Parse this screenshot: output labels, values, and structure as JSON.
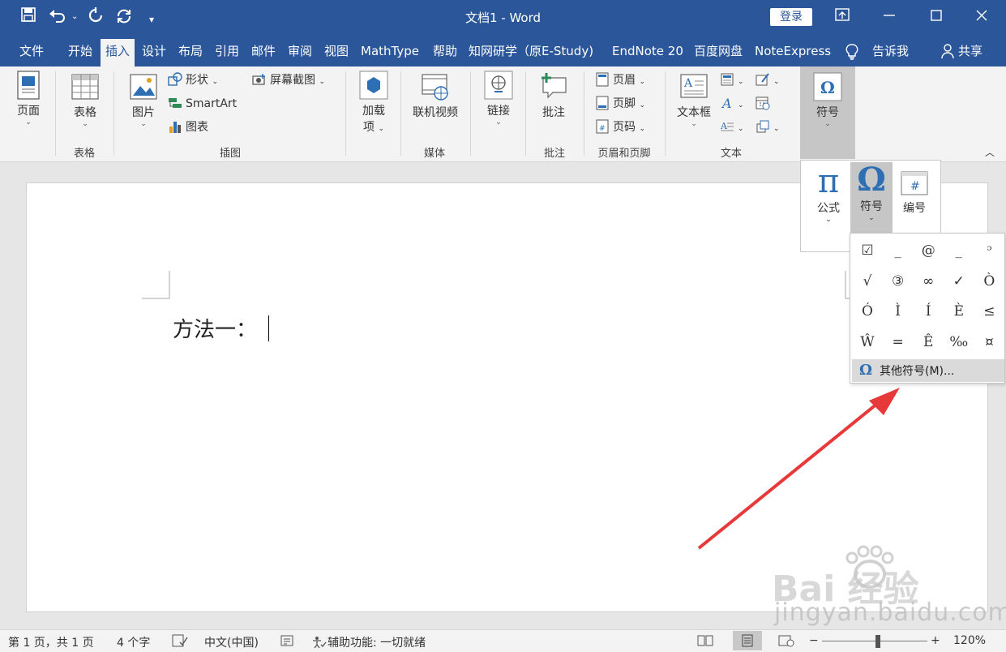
{
  "titlebar": {
    "title": "文档1  -  Word",
    "login_label": "登录",
    "quick_access": [
      "save-icon",
      "undo-icon",
      "redo-icon",
      "refresh-icon",
      "customize-icon"
    ]
  },
  "menu": {
    "tabs": [
      "文件",
      "开始",
      "插入",
      "设计",
      "布局",
      "引用",
      "邮件",
      "审阅",
      "视图",
      "MathType",
      "帮助",
      "知网研学（原E-Study)",
      "EndNote 20",
      "百度网盘",
      "NoteExpress",
      "告诉我",
      "共享"
    ],
    "active": "插入"
  },
  "ribbon": {
    "pages": {
      "label": "页面"
    },
    "table": {
      "label": "表格",
      "group": "表格"
    },
    "illustrations": {
      "picture": "图片",
      "shapes": "形状",
      "smartart": "SmartArt",
      "chart": "图表",
      "screenshot": "屏幕截图",
      "group": "插图"
    },
    "addins": {
      "label": "加载",
      "label2": "项"
    },
    "media": {
      "label": "联机视频",
      "group": "媒体"
    },
    "links": {
      "label": "链接"
    },
    "comments": {
      "label": "批注",
      "group": "批注"
    },
    "header_footer": {
      "header": "页眉",
      "footer": "页脚",
      "page_number": "页码",
      "group": "页眉和页脚"
    },
    "text": {
      "textbox": "文本框",
      "group": "文本"
    },
    "symbols": {
      "label": "符号"
    }
  },
  "document": {
    "text": "方法一："
  },
  "symbols_panel": {
    "equation": {
      "glyph": "π",
      "label": "公式"
    },
    "symbol": {
      "glyph": "Ω",
      "label": "符号"
    },
    "number": {
      "glyph": "#",
      "label": "编号"
    },
    "grid": [
      "☑",
      "_",
      "@",
      "_",
      "ᵓ",
      "√",
      "③",
      "∞",
      "✓",
      "Ò",
      "Ó",
      "Ì",
      "Í",
      "È",
      "≤",
      "Ŵ",
      "=",
      "Ê",
      "‰",
      "¤"
    ],
    "more": "其他符号(M)..."
  },
  "watermark": {
    "brand": "Bai 经验",
    "url": "jingyan.baidu.com"
  },
  "statusbar": {
    "pages": "第 1 页，共 1 页",
    "words": "4 个字",
    "language": "中文(中国)",
    "accessibility": "辅助功能: 一切就绪",
    "zoom": "120%"
  },
  "colors": {
    "accent": "#2b579a",
    "ribbon": "#f3f3f3",
    "arrow": "#e8393a"
  }
}
